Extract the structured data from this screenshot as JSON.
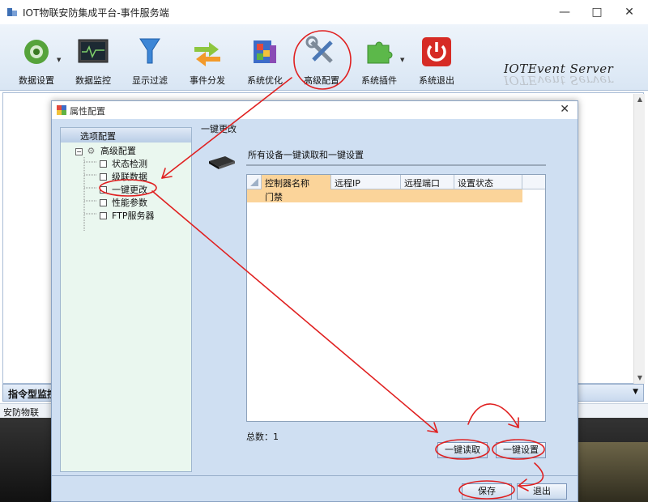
{
  "window": {
    "title": "IOT物联安防集成平台-事件服务端"
  },
  "toolbar": {
    "items": [
      {
        "label": "数据设置",
        "icon": "gear-icon"
      },
      {
        "label": "数据监控",
        "icon": "monitor-icon"
      },
      {
        "label": "显示过滤",
        "icon": "filter-icon"
      },
      {
        "label": "事件分发",
        "icon": "arrows-icon"
      },
      {
        "label": "系统优化",
        "icon": "optimize-icon"
      },
      {
        "label": "高级配置",
        "icon": "tools-icon"
      },
      {
        "label": "系统插件",
        "icon": "puzzle-icon"
      },
      {
        "label": "系统退出",
        "icon": "power-icon"
      }
    ],
    "brand": "IOTEvent Server"
  },
  "monitor_bar": {
    "label": "指令型监控"
  },
  "status_bar": {
    "text": "安防物联"
  },
  "dialog": {
    "title": "属性配置",
    "tree": {
      "header": "选项配置",
      "root": "高级配置",
      "children": [
        "状态检测",
        "级联数据",
        "一键更改",
        "性能参数",
        "FTP服务器"
      ]
    },
    "panel_title": "一键更改",
    "description": "所有设备一键读取和一键设置",
    "grid": {
      "columns": [
        "控制器名称",
        "远程IP",
        "远程端口",
        "设置状态"
      ],
      "rows": [
        [
          "门禁",
          "",
          "",
          ""
        ]
      ]
    },
    "total_label": "总数：1",
    "read_button": "一键读取",
    "set_button": "一键设置",
    "save_button": "保存",
    "exit_button": "退出"
  },
  "colors": {
    "annotation": "#e02020",
    "row_highlight": "#fbd49a",
    "tree_bg": "#eaf7ef",
    "dialog_bg": "#cfdff2"
  }
}
